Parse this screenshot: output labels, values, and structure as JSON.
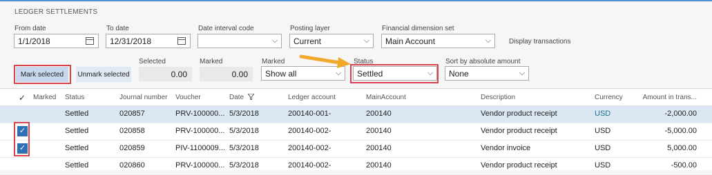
{
  "section_title": "LEDGER SETTLEMENTS",
  "filters": {
    "from_date": {
      "label": "From date",
      "value": "1/1/2018"
    },
    "to_date": {
      "label": "To date",
      "value": "12/31/2018"
    },
    "date_interval": {
      "label": "Date interval code",
      "value": ""
    },
    "posting_layer": {
      "label": "Posting layer",
      "value": "Current"
    },
    "fin_dim": {
      "label": "Financial dimension set",
      "value": "Main Account"
    },
    "display_transactions": "Display transactions"
  },
  "actions": {
    "mark_selected": "Mark selected",
    "unmark_selected": "Unmark selected",
    "selected": {
      "label": "Selected",
      "value": "0.00"
    },
    "marked_total": {
      "label": "Marked",
      "value": "0.00"
    },
    "marked_filter": {
      "label": "Marked",
      "value": "Show all"
    },
    "status": {
      "label": "Status",
      "value": "Settled"
    },
    "sort_abs": {
      "label": "Sort by absolute amount",
      "value": "None"
    }
  },
  "grid": {
    "headers": {
      "check": "✓",
      "marked": "Marked",
      "status": "Status",
      "journal": "Journal number",
      "voucher": "Voucher",
      "date": "Date",
      "ledger": "Ledger account",
      "main": "MainAccount",
      "desc": "Description",
      "currency": "Currency",
      "amount": "Amount in trans..."
    },
    "rows": [
      {
        "checked": false,
        "status": "Settled",
        "journal": "020857",
        "voucher": "PRV-100000...",
        "date": "5/3/2018",
        "ledger": "200140-001-",
        "main": "200140",
        "desc": "Vendor product receipt",
        "currency": "USD",
        "amount": "-2,000.00"
      },
      {
        "checked": true,
        "status": "Settled",
        "journal": "020858",
        "voucher": "PRV-100000...",
        "date": "5/3/2018",
        "ledger": "200140-002-",
        "main": "200140",
        "desc": "Vendor product receipt",
        "currency": "USD",
        "amount": "-5,000.00"
      },
      {
        "checked": true,
        "status": "Settled",
        "journal": "020859",
        "voucher": "PIV-1100009...",
        "date": "5/3/2018",
        "ledger": "200140-002-",
        "main": "200140",
        "desc": "Vendor invoice",
        "currency": "USD",
        "amount": "5,000.00"
      },
      {
        "checked": false,
        "status": "Settled",
        "journal": "020860",
        "voucher": "PRV-100000...",
        "date": "5/3/2018",
        "ledger": "200140-002-",
        "main": "200140",
        "desc": "Vendor product receipt",
        "currency": "USD",
        "amount": "-500.00"
      }
    ]
  },
  "colors": {
    "accent": "#2f6fb3",
    "highlight_border": "#d9424b",
    "arrow": "#f0a92a",
    "selected_row": "#dce7f4"
  }
}
